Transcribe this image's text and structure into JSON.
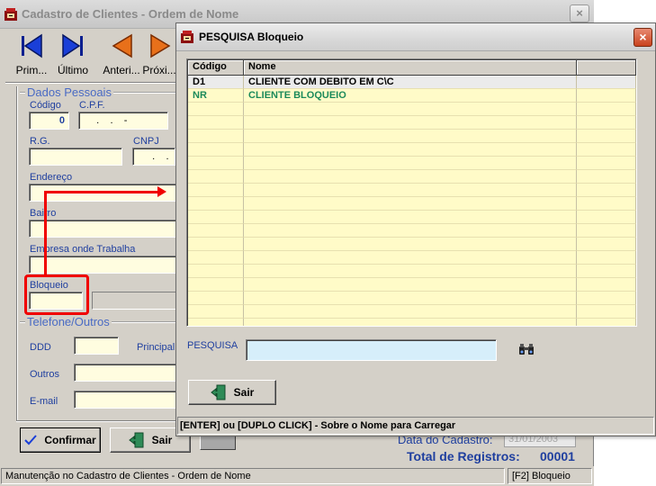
{
  "main_window": {
    "title": "Cadastro de Clientes - Ordem de Nome",
    "close_label": "×",
    "toolbar": {
      "first": {
        "label": "Prim...",
        "icon": "first-record-icon"
      },
      "last": {
        "label": "Último",
        "icon": "last-record-icon"
      },
      "prev": {
        "label": "Anteri...",
        "icon": "previous-record-icon"
      },
      "next": {
        "label": "Próxi...",
        "icon": "next-record-icon"
      }
    },
    "dados_pessoais": {
      "group_label": "Dados Pessoais",
      "codigo": {
        "label": "Código",
        "value": "0"
      },
      "cpf": {
        "label": "C.P.F.",
        "value": "   .    .    -"
      },
      "rg": {
        "label": "R.G.",
        "value": ""
      },
      "cnpj": {
        "label": "CNPJ",
        "value": "   .    ."
      },
      "endereco": {
        "label": "Endereço",
        "value": ""
      },
      "bairro": {
        "label": "Bairro",
        "value": ""
      },
      "empresa": {
        "label": "Empresa onde Trabalha",
        "value": ""
      },
      "bloqueio": {
        "label": "Bloqueio",
        "value": ""
      }
    },
    "telefone_outros": {
      "group_label": "Telefone/Outros",
      "ddd": {
        "label": "DDD",
        "value": ""
      },
      "principal": {
        "label": "Principal"
      },
      "outros": {
        "label": "Outros",
        "value": ""
      },
      "email": {
        "label": "E-mail",
        "value": ""
      }
    },
    "buttons": {
      "confirmar": "Confirmar",
      "sair": "Sair"
    },
    "data_cadastro": {
      "label": "Data do Cadastro:",
      "value": "31/01/2003"
    },
    "total_registros": {
      "label": "Total de Registros:",
      "value": "00001"
    },
    "status": {
      "left": "Manutenção no Cadastro de Clientes - Ordem de Nome",
      "right": "[F2] Bloqueio"
    }
  },
  "dialog": {
    "title": "PESQUISA Bloqueio",
    "close_label": "×",
    "grid": {
      "columns": [
        "Código",
        "Nome",
        ""
      ],
      "rows": [
        {
          "codigo": "D1",
          "nome": "CLIENTE COM DEBITO EM C\\C"
        },
        {
          "codigo": "NR",
          "nome": "CLIENTE BLOQUEIO"
        }
      ]
    },
    "search": {
      "label": "PESQUISA",
      "value": ""
    },
    "sair_label": "Sair",
    "hint": "[ENTER] ou [DUPLO CLICK] - Sobre o Nome para Carregar"
  },
  "colors": {
    "annotation": "#f00000",
    "field_bg": "#fffde0",
    "grid_bg": "#fffbc8",
    "label_blue": "#1f3f9f",
    "green_row": "#1b8a5a"
  }
}
